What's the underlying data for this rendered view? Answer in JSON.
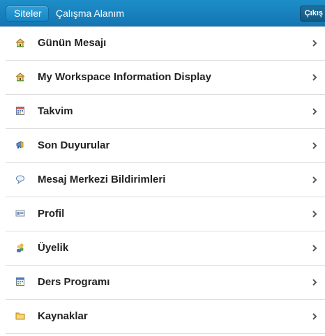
{
  "header": {
    "back_label": "Siteler",
    "title": "Çalışma Alanım",
    "logout_label": "Çıkış",
    "bar_color": "#1a86c1"
  },
  "menu": {
    "items": [
      {
        "label": "Günün Mesajı",
        "icon": "home-icon"
      },
      {
        "label": "My Workspace Information Display",
        "icon": "home-icon"
      },
      {
        "label": "Takvim",
        "icon": "calendar-icon"
      },
      {
        "label": "Son Duyurular",
        "icon": "megaphone-icon"
      },
      {
        "label": "Mesaj Merkezi Bildirimleri",
        "icon": "speech-bubble-icon"
      },
      {
        "label": "Profil",
        "icon": "id-card-icon"
      },
      {
        "label": "Üyelik",
        "icon": "users-icon"
      },
      {
        "label": "Ders Programı",
        "icon": "calendar-icon"
      },
      {
        "label": "Kaynaklar",
        "icon": "folder-icon"
      }
    ]
  }
}
